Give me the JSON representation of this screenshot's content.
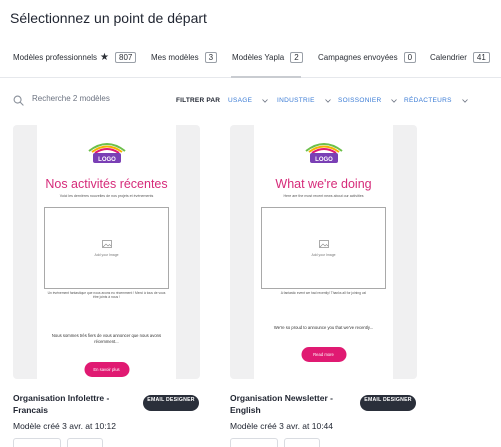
{
  "page": {
    "title": "Sélectionnez un point de départ"
  },
  "tabs": [
    {
      "label": "Modèles professionnels",
      "count": "807",
      "has_star": true
    },
    {
      "label": "Mes modèles",
      "count": "3"
    },
    {
      "label": "Modèles Yapla",
      "count": "2",
      "active": true
    },
    {
      "label": "Campagnes envoyées",
      "count": "0"
    },
    {
      "label": "Calendrier",
      "count": "41"
    }
  ],
  "search": {
    "placeholder": "Recherche 2 modèles"
  },
  "filters": {
    "label": "FILTRER PAR",
    "items": [
      "USAGE",
      "INDUSTRIE",
      "SOISSONIER",
      "RÉDACTEURS"
    ]
  },
  "templates": [
    {
      "preview": {
        "heading": "Nos activités récentes",
        "subheading": "Voici les dernières nouvelles de nos projets et événements",
        "image_placeholder": "Add your Image",
        "note": "Un événement fantastique que nous avons eu récemment ! Merci à tous de vous être joints à nous !",
        "body_text": "Nous sommes très fiers de vous annoncer que nous avons récemment...",
        "cta_label": "En savoir plus"
      },
      "name": "Organisation Infolettre - Francais",
      "created": "Modèle créé 3 avr. at 10:12",
      "badge": "EMAIL DESIGNER"
    },
    {
      "preview": {
        "heading": "What we're doing",
        "subheading": "Here are the most recent news about our activities",
        "image_placeholder": "Add your Image",
        "note": "A fantastic event we had recently! Thanks all for joining us!",
        "body_text": "We're so proud to announce you that we've recently...",
        "cta_label": "Read more"
      },
      "name": "Organisation Newsletter - English",
      "created": "Modèle créé 3 avr. at 10:44",
      "badge": "EMAIL DESIGNER"
    }
  ],
  "colors": {
    "accent_link": "#3a7bd5",
    "brand_pink": "#d62b7a",
    "cta_pink": "#e01a72",
    "badge_dark": "#2a2f3a"
  }
}
